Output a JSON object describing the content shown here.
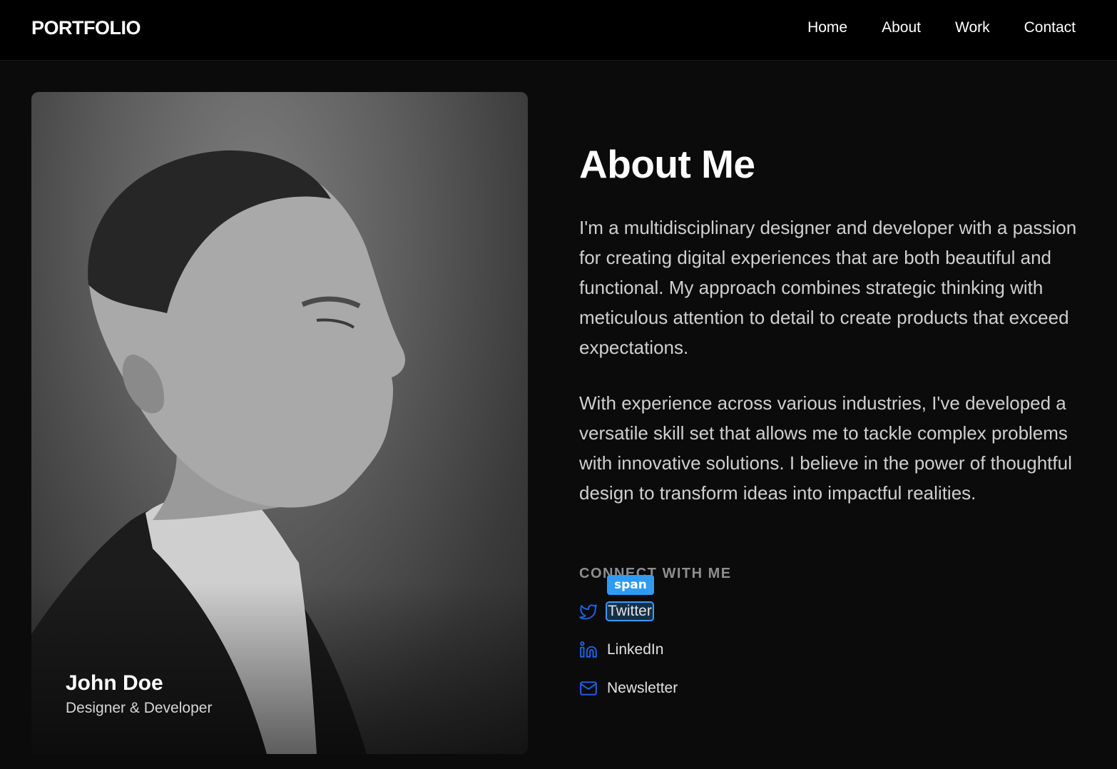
{
  "header": {
    "logo": "PORTFOLIO",
    "nav": [
      "Home",
      "About",
      "Work",
      "Contact"
    ]
  },
  "profile": {
    "name": "John Doe",
    "role": "Designer & Developer"
  },
  "about": {
    "title": "About Me",
    "paragraphs": [
      "I'm a multidisciplinary designer and developer with a passion for creating digital experiences that are both beautiful and functional. My approach combines strategic thinking with meticulous attention to detail to create products that exceed expectations.",
      "With experience across various industries, I've developed a versatile skill set that allows me to tackle complex problems with innovative solutions. I believe in the power of thoughtful design to transform ideas into impactful realities."
    ]
  },
  "connect": {
    "heading": "CONNECT WITH ME",
    "links": [
      {
        "label": "Twitter",
        "icon": "twitter-icon"
      },
      {
        "label": "LinkedIn",
        "icon": "linkedin-icon"
      },
      {
        "label": "Newsletter",
        "icon": "mail-icon"
      }
    ]
  },
  "inspector": {
    "tag": "span"
  },
  "colors": {
    "accent": "#1e63e6",
    "highlight": "#3b9cf5",
    "background": "#0b0b0b"
  }
}
